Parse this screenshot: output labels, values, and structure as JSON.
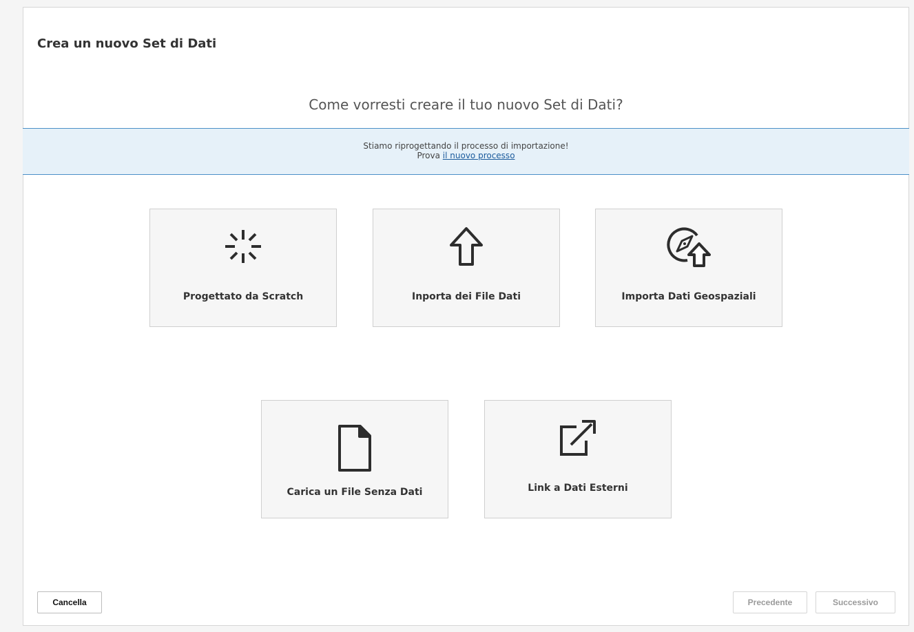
{
  "dialog": {
    "title": "Crea un nuovo Set di Dati",
    "question": "Come vorresti creare il tuo nuovo Set di Dati?"
  },
  "notice": {
    "line1": "Stiamo riprogettando il processo di importazione!",
    "line2_prefix": "Prova ",
    "link_text": "il nuovo processo"
  },
  "options": [
    {
      "label": "Progettato da Scratch",
      "icon": "spinner-burst-icon"
    },
    {
      "label": "Inporta dei File Dati",
      "icon": "upload-arrow-icon"
    },
    {
      "label": "Importa Dati Geospaziali",
      "icon": "compass-upload-icon"
    },
    {
      "label": "Carica un File Senza Dati",
      "icon": "blank-file-icon"
    },
    {
      "label": "Link a Dati Esterni",
      "icon": "external-link-icon"
    }
  ],
  "footer": {
    "cancel_label": "Cancella",
    "previous_label": "Precedente",
    "next_label": "Successivo"
  },
  "colors": {
    "notice_bg": "#e6f1f9",
    "notice_border": "#4a8fc7",
    "card_bg": "#f6f6f6"
  }
}
